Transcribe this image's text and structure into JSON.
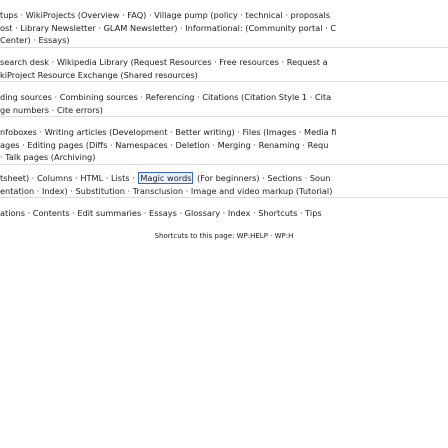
{
  "navbox": {
    "row1": {
      "line1": "tups · WikiProjects (Overview · FAQ) · Village pump (policy · technical · proposals",
      "line2": "ost · Library Newsletter · GLAM Newsletter) · Informational: (Community portal · C",
      "line3": "Center) · Essays)"
    },
    "row2": {
      "line1": "search desk · Wikipedia Library (Request Resources · Free resources · Request a",
      "line2": "kiProject Resource Exchange (Shared resources)"
    },
    "row3": {
      "line1": "ding sources · Combining sources · Referencing · Citations (Citation Style 1 · Cita",
      "line2": "ge numbers · Cite errors)"
    },
    "row4": {
      "line1": "nfoboxes · Writing articles (Development · Better writing) · Files (Images · Media fi",
      "line2": "ages · Editing pages (Diffs · Namespaces · Deletion · Merging · Renaming · Requ",
      "line3": "· Talk pages (Archiving)"
    },
    "row5": {
      "line1_pre": "tsheet) · Columns · HTML · Lists · ",
      "line1_highlight": "Magic words",
      "line1_post": " (For beginners) · Sections · Soun",
      "line2": "entation · Index) · Substitution · Transclusion · Image and video markup (Tutorial)"
    },
    "row6": {
      "line1": "ations · Contents · Edit summaries · Essays · Glossary · Index · Shortcuts · Tips"
    }
  },
  "shortcuts": {
    "text": "Shortcuts to this page: WP:HELP · WP:H"
  }
}
